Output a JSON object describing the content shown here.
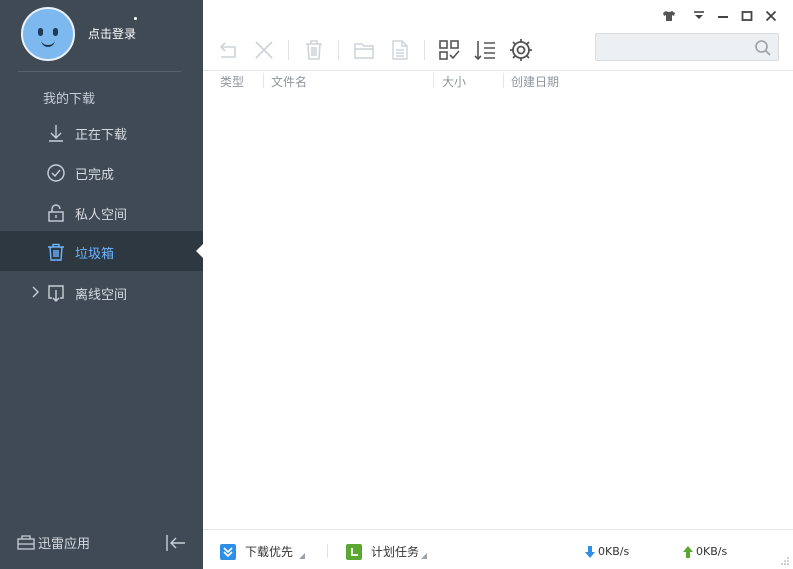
{
  "user": {
    "login_text": "点击登录"
  },
  "sidebar": {
    "section_title": "我的下载",
    "items": [
      {
        "label": "正在下载",
        "icon": "download-icon"
      },
      {
        "label": "已完成",
        "icon": "check-circle-icon"
      },
      {
        "label": "私人空间",
        "icon": "lock-icon"
      },
      {
        "label": "垃圾箱",
        "icon": "trash-icon",
        "active": true
      },
      {
        "label": "离线空间",
        "icon": "cloud-download-icon"
      }
    ],
    "apps_label": "迅雷应用"
  },
  "toolbar": {
    "search_placeholder": ""
  },
  "table": {
    "columns": [
      "类型",
      "文件名",
      "大小",
      "创建日期"
    ]
  },
  "status": {
    "download_priority": "下载优先",
    "scheduled_tasks": "计划任务",
    "download_speed": "0KB/s",
    "upload_speed": "0KB/s"
  },
  "colors": {
    "sidebar_bg": "#3f4a55",
    "active_bg": "#2e3841",
    "active_text": "#6eb3ff",
    "download_arrow": "#2f8fe6",
    "upload_arrow": "#5aa832"
  }
}
